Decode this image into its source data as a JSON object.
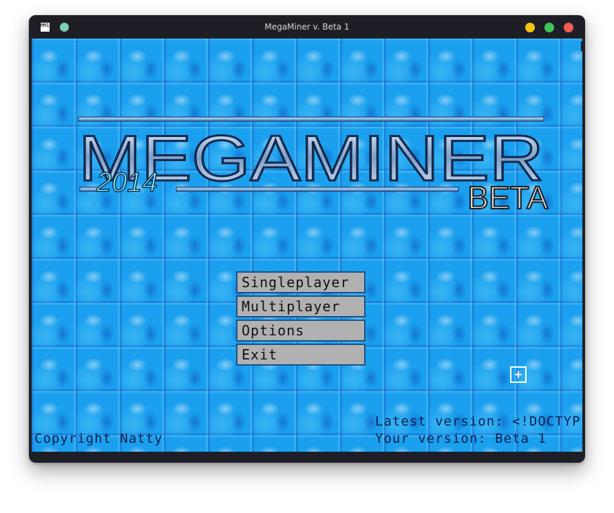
{
  "window": {
    "title": "MegaMiner v. Beta 1",
    "app_icon_text": "MM14"
  },
  "logo": {
    "main_text": "MEGAMINER",
    "year_text": "2014",
    "tag_text": "BETA"
  },
  "menu": {
    "items": [
      {
        "label": "Singleplayer"
      },
      {
        "label": "Multiplayer"
      },
      {
        "label": "Options"
      },
      {
        "label": "Exit"
      }
    ]
  },
  "plus_button": {
    "label": "+"
  },
  "footer": {
    "copyright": "Copyright Natty",
    "latest_version": "Latest version: <!DOCTYP",
    "your_version": "Your version: Beta 1"
  },
  "colors": {
    "background": "#1aa0ee",
    "button_fill": "#b1b1b1",
    "button_border": "#1d4f86",
    "footer_text": "#0b1f4f"
  }
}
